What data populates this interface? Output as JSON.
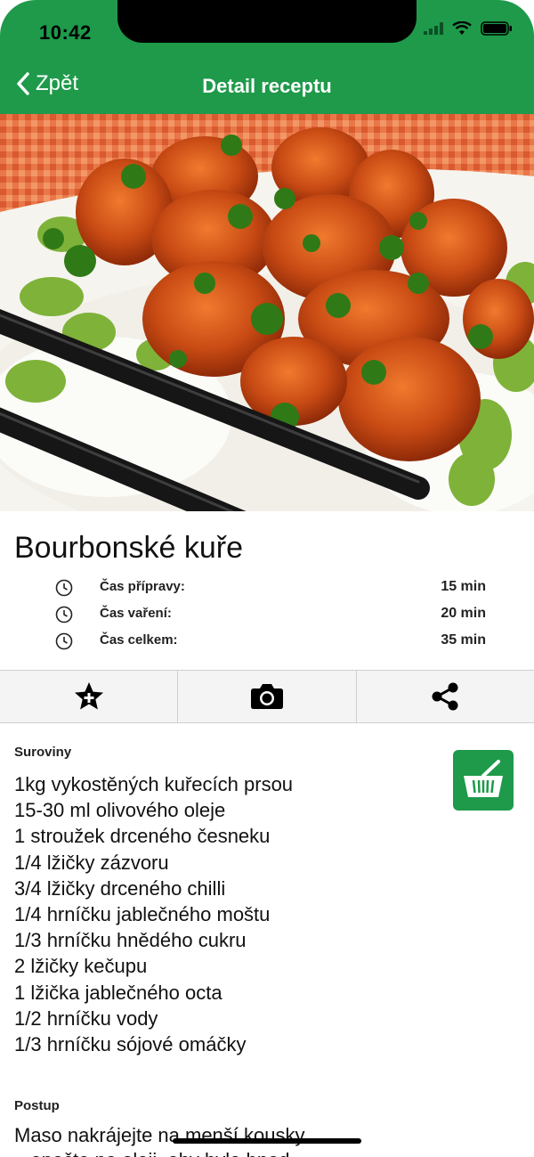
{
  "status_bar": {
    "time": "10:42"
  },
  "nav": {
    "back_label": "Zpět",
    "title": "Detail receptu"
  },
  "hero": {
    "icon": "food-photo"
  },
  "recipe": {
    "title": "Bourbonské kuře",
    "times": [
      {
        "label": "Čas přípravy:",
        "value": "15 min"
      },
      {
        "label": "Čas vaření:",
        "value": "20 min"
      },
      {
        "label": "Čas celkem:",
        "value": "35 min"
      }
    ]
  },
  "actions": [
    {
      "icon": "star-plus-icon"
    },
    {
      "icon": "camera-icon"
    },
    {
      "icon": "share-icon"
    }
  ],
  "ingredients": {
    "heading": "Suroviny",
    "items": [
      "1kg vykostěných kuřecích prsou",
      "15-30 ml olivového oleje",
      "1 stroužek drceného česneku",
      "1/4 lžičky zázvoru",
      "3/4 lžičky drceného chilli",
      "1/4 hrníčku jablečného moštu",
      "1/3 hrníčku hnědého cukru",
      "2 lžičky kečupu",
      "1 lžička jablečného octa",
      "1/2 hrníčku vody",
      "1/3 hrníčku sójové omáčky"
    ]
  },
  "steps": {
    "heading": "Postup",
    "text": "Maso nakrájejte na menší kousky",
    "text2": "a opečte na oleji, aby bylo hned"
  },
  "colors": {
    "accent": "#1e9a4a"
  }
}
